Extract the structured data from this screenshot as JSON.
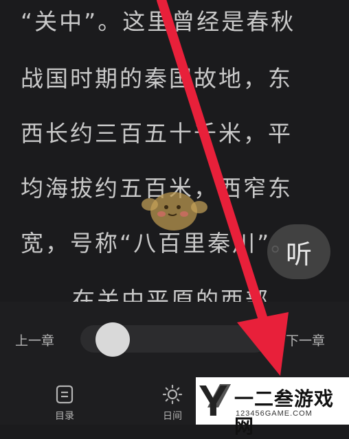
{
  "reader": {
    "lines": [
      "“关中”。这里曾经是春秋",
      "战国时期的秦国故地，东",
      "西长约三百五十千米，平",
      "均海拔约五百米，西窄东",
      "宽，号称“八百里秦川”。",
      "在关中平原的西部"
    ],
    "listen_label": "听"
  },
  "controls": {
    "prev_chapter": "上一章",
    "next_chapter": "下一章",
    "progress": 0.08
  },
  "tabs": [
    {
      "label": "目录",
      "icon": "catalog-icon"
    },
    {
      "label": "日间",
      "icon": "sun-icon"
    }
  ],
  "watermark": {
    "letter": "Y",
    "title": "一二叁游戏网",
    "url": "123456GAME.COM"
  },
  "colors": {
    "background": "#1b1b1d",
    "text": "#c9c9c9",
    "arrow": "#e8203a"
  }
}
